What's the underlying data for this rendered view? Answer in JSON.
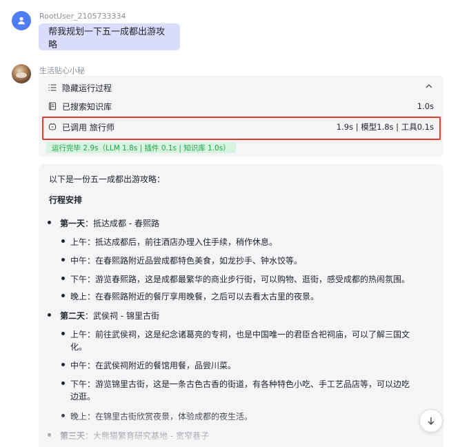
{
  "user": {
    "name": "RootUser_2105733334",
    "message": "帮我规划一下五一成都出游攻略"
  },
  "bot": {
    "name": "生活贴心小秘"
  },
  "process": {
    "toggle_label": "隐藏运行过程",
    "steps": [
      {
        "label": "已搜索知识库",
        "time": "1.0s"
      },
      {
        "label": "已调用 旅行师",
        "time": "1.9s | 模型1.8s | 工具0.1s"
      }
    ],
    "summary": "运行完毕 2.9s（LLM 1.8s | 插件 0.1s | 知识库 1.0s）"
  },
  "answer": {
    "intro": "以下是一份五一成都出游攻略：",
    "heading": "行程安排",
    "days": [
      {
        "title": "第一天",
        "place": "：抵达成都 - 春熙路",
        "items": [
          "上午：抵达成都后，前往酒店办理入住手续，稍作休息。",
          "中午：在春熙路附近品尝成都特色美食，如龙抄手、钟水饺等。",
          "下午：游览春熙路，这是成都最繁华的商业步行街，可以购物、逛街，感受成都的热闹氛围。",
          "晚上：在春熙路附近的餐厅享用晚餐，之后可以去看太古里的夜景。"
        ]
      },
      {
        "title": "第二天",
        "place": "：武侯祠 - 锦里古街",
        "items": [
          "上午：前往武侯祠，这是纪念诸葛亮的专祠，也是中国唯一的君臣合祀祠庙，可以了解三国文",
          "化。",
          "中午：在武侯祠附近的餐馆用餐，品尝川菜。",
          "下午：游览锦里古街，这是一条古色古香的街道，有各种特色小吃、手工艺品店等，可以边吃",
          "边逛。",
          "晚上：在锦里古街欣赏夜景，体验成都的夜生活。"
        ]
      },
      {
        "title": "第三天",
        "place": "：大熊猫繁育研究基地 - 宽窄巷子"
      }
    ]
  }
}
